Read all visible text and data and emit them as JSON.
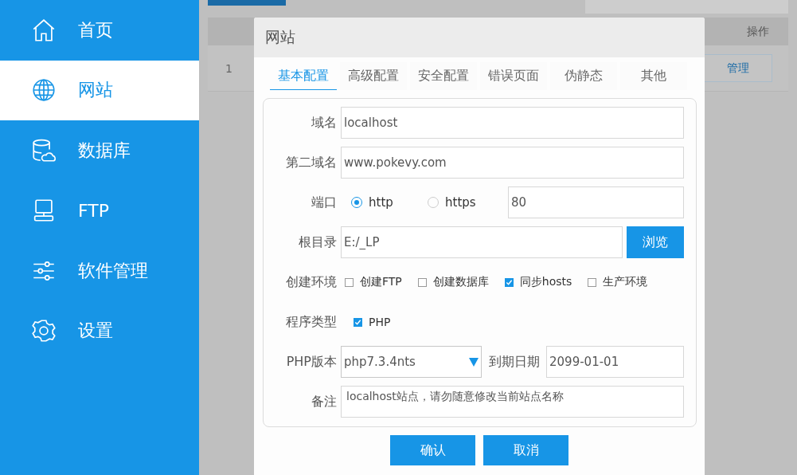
{
  "sidebar": {
    "items": [
      {
        "label": "首页",
        "selected": false
      },
      {
        "label": "网站",
        "selected": true
      },
      {
        "label": "数据库",
        "selected": false
      },
      {
        "label": "FTP",
        "selected": false
      },
      {
        "label": "软件管理",
        "selected": false
      },
      {
        "label": "设置",
        "selected": false
      }
    ]
  },
  "table": {
    "columns": [
      "操作"
    ],
    "rows": [
      {
        "index": "1",
        "action": "管理"
      }
    ]
  },
  "dialog": {
    "title": "网站",
    "tabs": [
      {
        "label": "基本配置",
        "selected": true
      },
      {
        "label": "高级配置",
        "selected": false
      },
      {
        "label": "安全配置",
        "selected": false
      },
      {
        "label": "错误页面",
        "selected": false
      },
      {
        "label": "伪静态",
        "selected": false
      },
      {
        "label": "其他",
        "selected": false
      }
    ],
    "domain": {
      "label": "域名",
      "value": "localhost"
    },
    "second_domain": {
      "label": "第二域名",
      "value": "www.pokevy.com"
    },
    "port": {
      "label": "端口",
      "options": [
        {
          "label": "http",
          "selected": true
        },
        {
          "label": "https",
          "selected": false
        }
      ],
      "value": "80"
    },
    "root": {
      "label": "根目录",
      "value": "E:/_LP",
      "button": "浏览"
    },
    "environment": {
      "label": "创建环境",
      "options": [
        {
          "label": "创建FTP",
          "checked": false
        },
        {
          "label": "创建数据库",
          "checked": false
        },
        {
          "label": "同步hosts",
          "checked": true
        },
        {
          "label": "生产环境",
          "checked": false
        }
      ]
    },
    "program_type": {
      "label": "程序类型",
      "options": [
        {
          "label": "PHP",
          "checked": true
        }
      ]
    },
    "php_version": {
      "label": "PHP版本",
      "value": "php7.3.4nts"
    },
    "expiry": {
      "label": "到期日期",
      "value": "2099-01-01"
    },
    "remark": {
      "label": "备注",
      "value": "localhost站点，请勿随意修改当前站点名称"
    },
    "buttons": [
      "确认",
      "取消"
    ]
  }
}
